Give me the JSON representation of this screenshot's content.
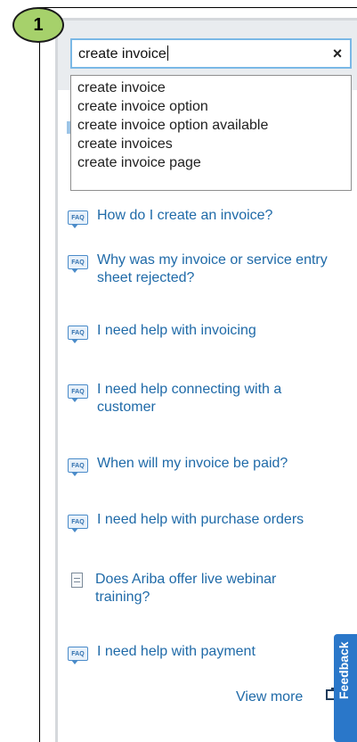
{
  "step_badge": "1",
  "search": {
    "value": "create invoice",
    "clear_glyph": "×"
  },
  "suggestions": [
    "create invoice",
    "create invoice option",
    "create invoice option available",
    "create invoices",
    "create invoice page"
  ],
  "faqs": [
    {
      "icon": "faq-icon",
      "lines": [
        "How do I create an invoice?"
      ]
    },
    {
      "icon": "faq-icon",
      "lines": [
        "Why was my invoice or service entry",
        "sheet rejected?"
      ]
    },
    {
      "icon": "faq-icon",
      "lines": [
        "I need help with invoicing"
      ]
    },
    {
      "icon": "faq-icon",
      "lines": [
        "I need help connecting with a",
        "customer"
      ]
    },
    {
      "icon": "faq-icon",
      "lines": [
        "When will my invoice be paid?"
      ]
    },
    {
      "icon": "faq-icon",
      "lines": [
        "I need help with purchase orders"
      ]
    },
    {
      "icon": "document-icon",
      "lines": [
        "Does Ariba offer live webinar",
        "training?"
      ]
    },
    {
      "icon": "faq-icon",
      "lines": [
        "I need help with payment"
      ]
    }
  ],
  "faq_icon_text": "FAQ",
  "view_more": "View more",
  "feedback": "Feedback",
  "colors": {
    "badge": "#a6d16b",
    "link": "#1f6aa8",
    "search_border": "#7ab8e6",
    "feedback_tab": "#2a77c9"
  }
}
